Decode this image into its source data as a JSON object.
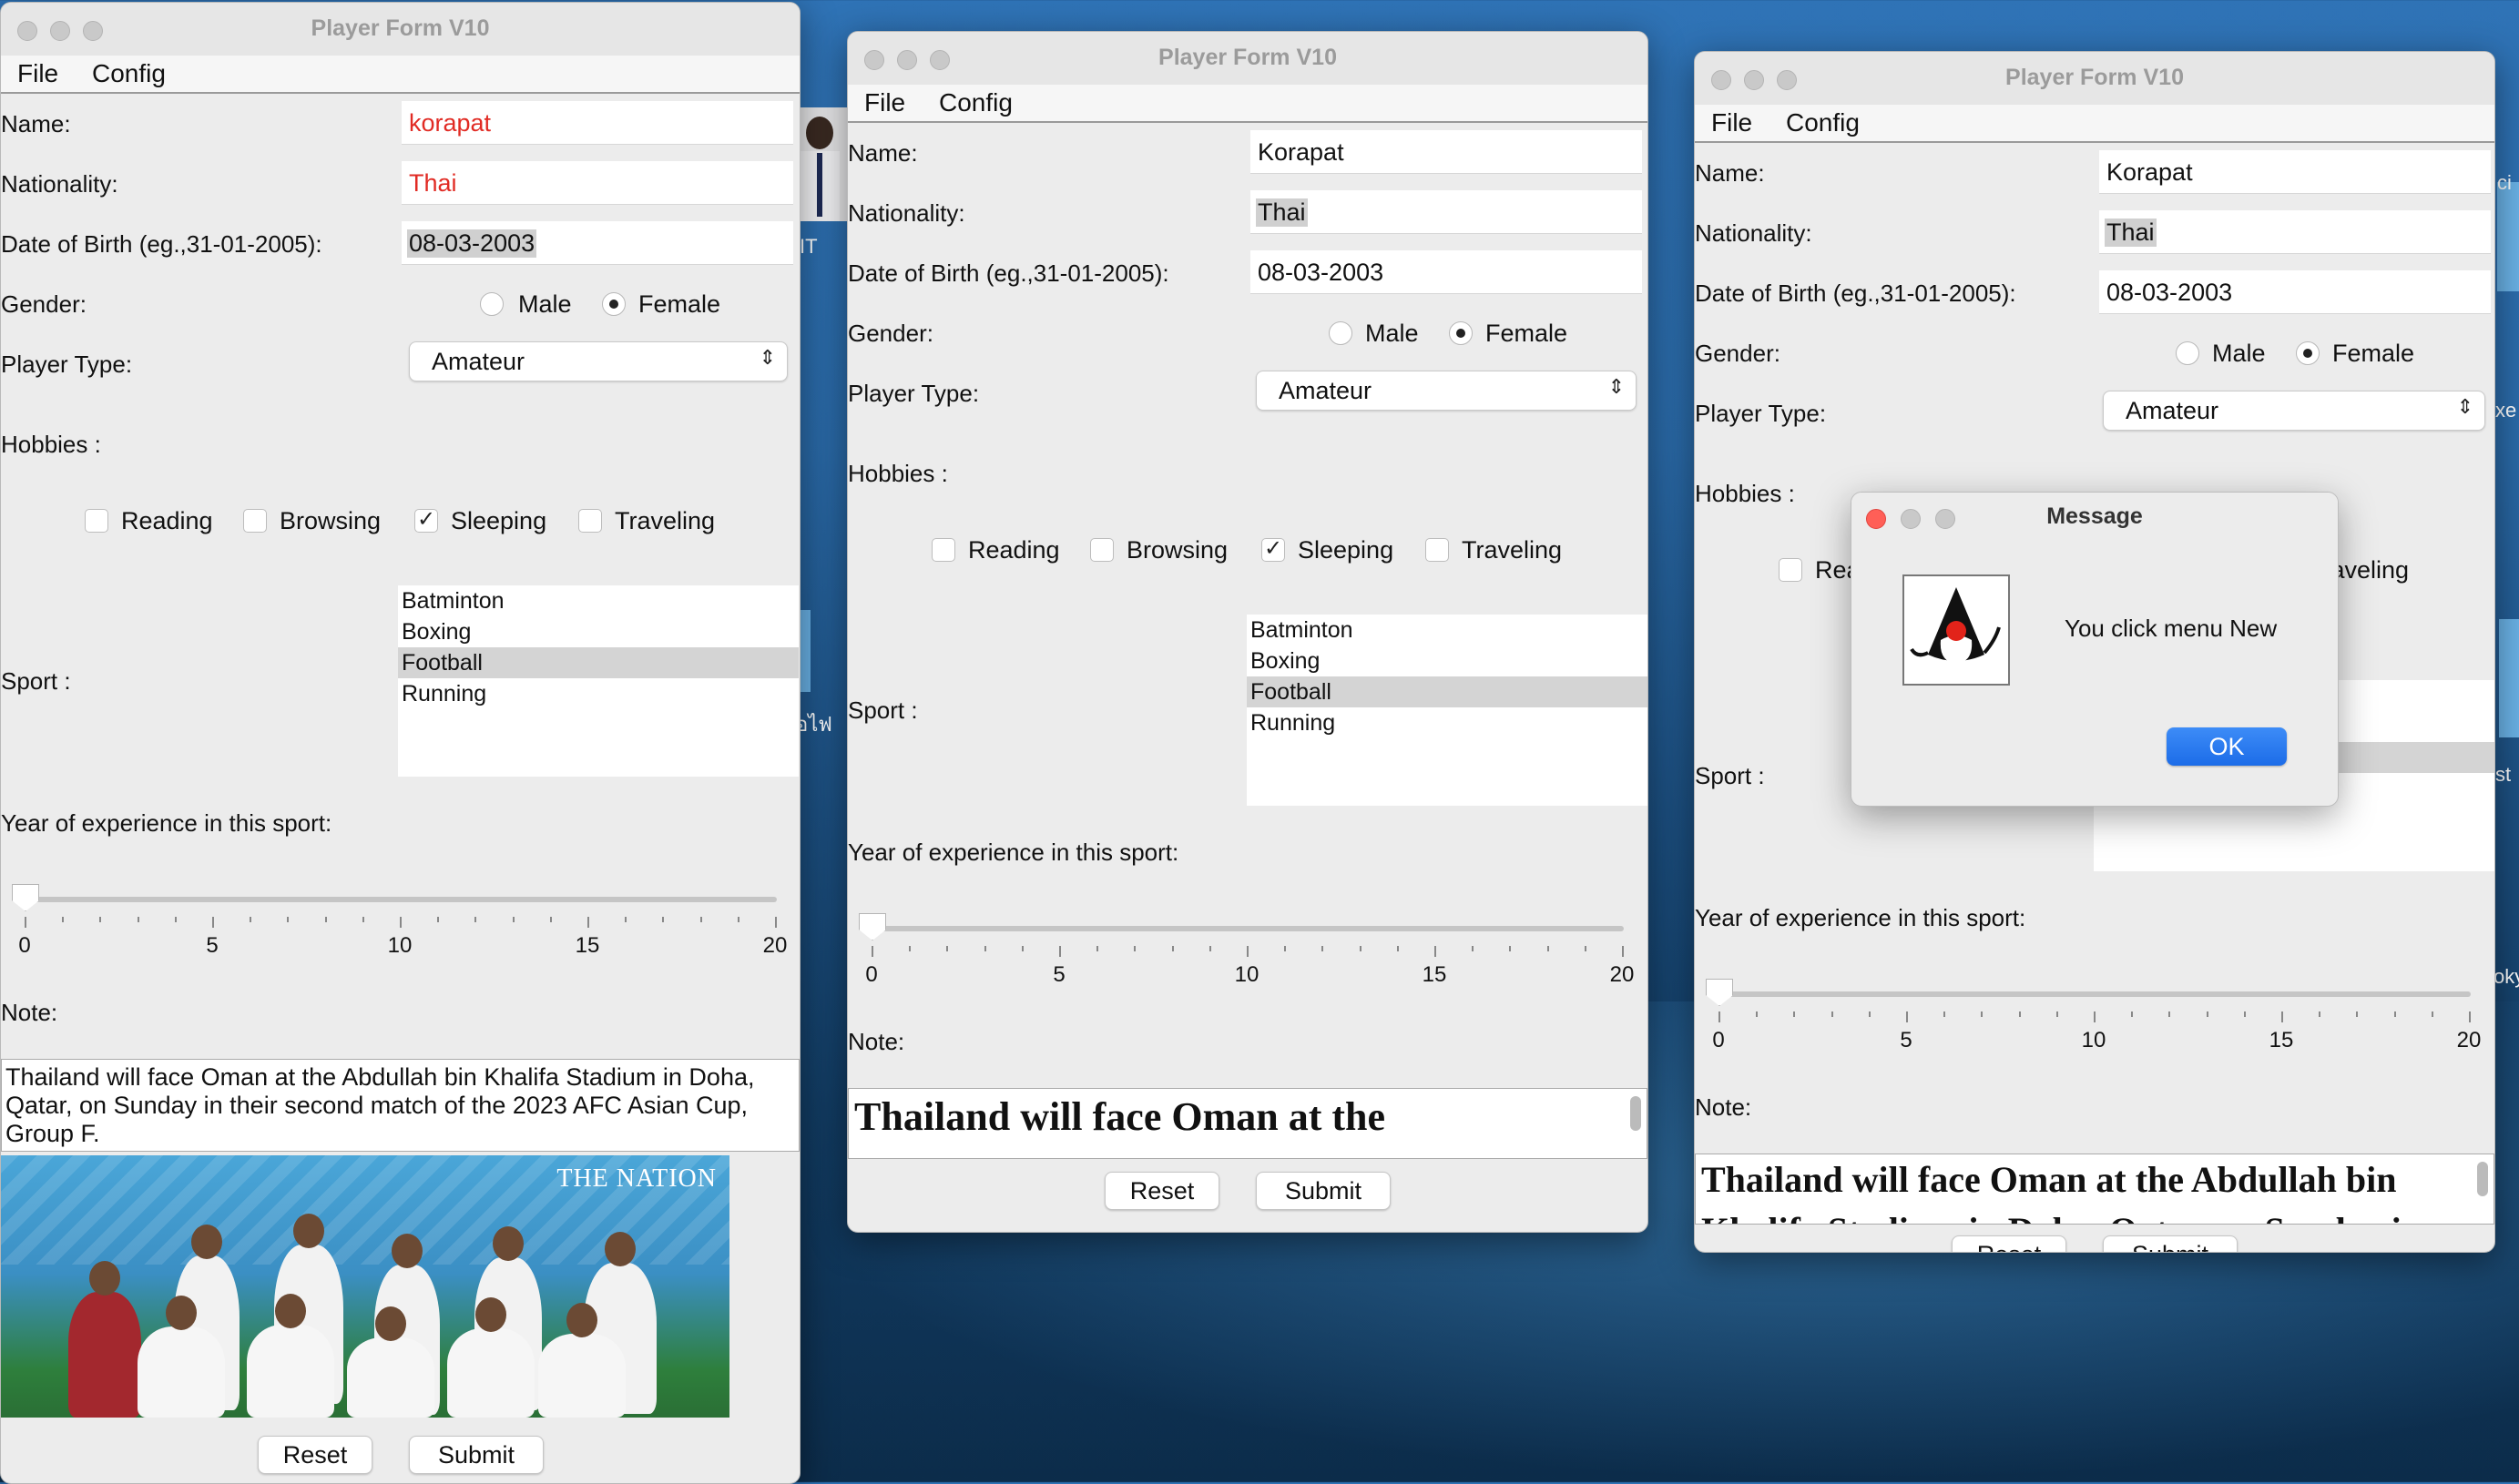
{
  "window_title": "Player Form V10",
  "menu": {
    "file": "File",
    "config": "Config"
  },
  "labels": {
    "name": "Name:",
    "nationality": "Nationality:",
    "dob": "Date of Birth (eg.,31-01-2005):",
    "gender": "Gender:",
    "player_type": "Player Type:",
    "hobbies": "Hobbies :",
    "sport": "Sport :",
    "experience": "Year of experience in this sport:",
    "note": "Note:"
  },
  "gender_options": [
    "Male",
    "Female"
  ],
  "hobby_options": [
    "Reading",
    "Browsing",
    "Sleeping",
    "Traveling"
  ],
  "sport_options": [
    "Batminton",
    "Boxing",
    "Football",
    "Running"
  ],
  "slider": {
    "min": 0,
    "max": 20,
    "value": 0,
    "tick_labels": [
      "0",
      "5",
      "10",
      "15",
      "20"
    ]
  },
  "note_text": "Thailand will face Oman at the Abdullah bin Khalifa Stadium in Doha, Qatar, on Sunday in their second match of the 2023 AFC Asian Cup, Group F.",
  "buttons": {
    "reset": "Reset",
    "submit": "Submit"
  },
  "windows": [
    {
      "name_value": "korapat",
      "nationality_value": "Thai",
      "dob_value": "08-03-2003",
      "gender_selected": "Female",
      "player_type": "Amateur",
      "hobbies_checked": [
        "Sleeping"
      ],
      "sport_selected": "Football",
      "slider_value": 0
    },
    {
      "name_value": "Korapat",
      "nationality_value": "Thai",
      "dob_value": "08-03-2003",
      "gender_selected": "Female",
      "player_type": "Amateur",
      "hobbies_checked": [
        "Sleeping"
      ],
      "sport_selected": "Football",
      "slider_value": 0,
      "note_visible": "Thailand will face Oman at the",
      "note_partial": "Abdullah bin Khalifa Stadium in Doh"
    },
    {
      "name_value": "Korapat",
      "nationality_value": "Thai",
      "dob_value": "08-03-2003",
      "gender_selected": "Female",
      "player_type": "Amateur",
      "hobbies_checked": [
        "Sleeping"
      ],
      "sport_selected": "Football",
      "slider_value": 0,
      "note_visible": "Thailand will face Oman at the Abdullah bin",
      "note_partial": "Khalifa Stadium in Doha, Qatar, on Sunday in"
    }
  ],
  "image_watermark": "THE NATION",
  "dialog": {
    "title": "Message",
    "message": "You click menu New",
    "ok": "OK"
  },
  "background_fragments": [
    "IT",
    "อไฟ",
    "ci",
    "xe",
    "st",
    "oky"
  ],
  "colors": {
    "error_text": "#e12b24",
    "ok_button": "#1c6ce8",
    "close_dot": "#ff5f57"
  }
}
